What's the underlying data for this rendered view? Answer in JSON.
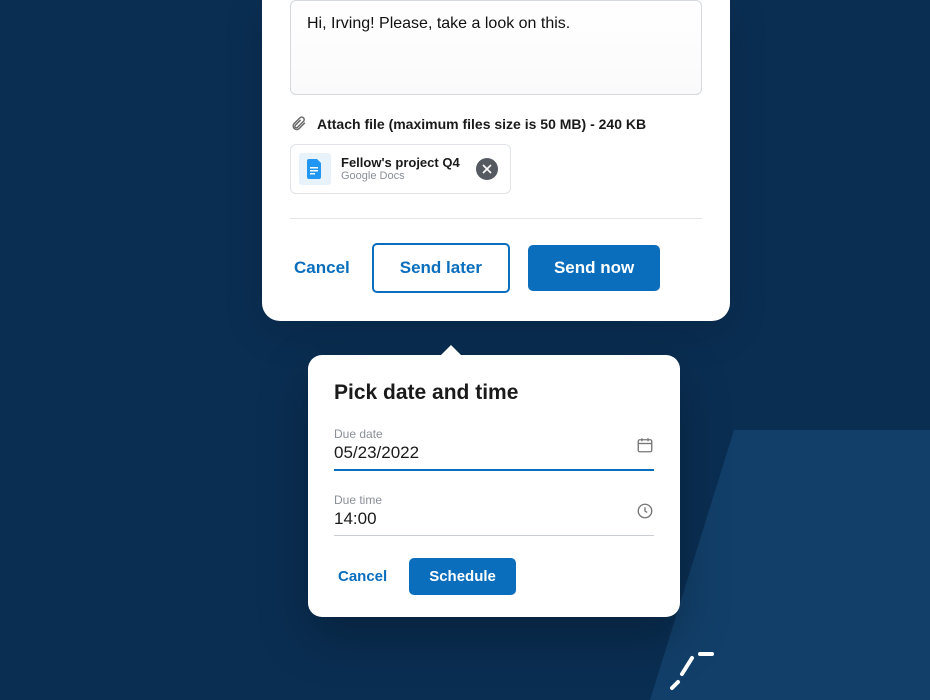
{
  "compose": {
    "message": "Hi, Irving! Please, take a look on this.",
    "attach_label": "Attach file (maximum files size is 50 MB) - 240 KB",
    "file": {
      "name": "Fellow's project Q4",
      "type": "Google Docs"
    },
    "buttons": {
      "cancel": "Cancel",
      "send_later": "Send later",
      "send_now": "Send now"
    }
  },
  "popover": {
    "title": "Pick date and time",
    "due_date": {
      "label": "Due date",
      "value": "05/23/2022"
    },
    "due_time": {
      "label": "Due time",
      "value": "14:00"
    },
    "buttons": {
      "cancel": "Cancel",
      "schedule": "Schedule"
    }
  },
  "colors": {
    "primary": "#0a6ebd",
    "bg_dark": "#0a2e52"
  }
}
